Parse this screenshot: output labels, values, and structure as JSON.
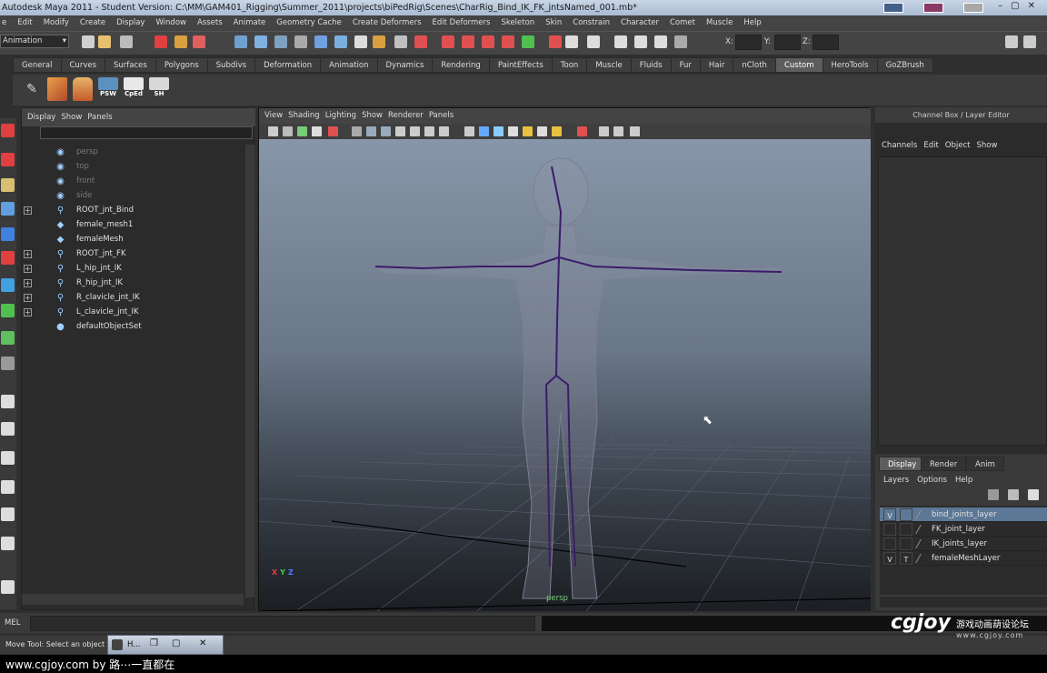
{
  "window": {
    "title": "Autodesk Maya 2011 - Student Version: C:\\MM\\GAM401_Rigging\\Summer_2011\\projects\\biPedRig\\Scenes\\CharRig_Bind_IK_FK_jntsNamed_001.mb*"
  },
  "menubar": [
    "e",
    "Edit",
    "Modify",
    "Create",
    "Display",
    "Window",
    "Assets",
    "Animate",
    "Geometry Cache",
    "Create Deformers",
    "Edit Deformers",
    "Skeleton",
    "Skin",
    "Constrain",
    "Character",
    "Comet",
    "Muscle",
    "Help"
  ],
  "statusline": {
    "mode": "Animation",
    "x_label": "X:",
    "y_label": "Y:",
    "z_label": "Z:"
  },
  "shelf": {
    "tabs": [
      "General",
      "Curves",
      "Surfaces",
      "Polygons",
      "Subdivs",
      "Deformation",
      "Animation",
      "Dynamics",
      "Rendering",
      "PaintEffects",
      "Toon",
      "Muscle",
      "Fluids",
      "Fur",
      "Hair",
      "nCloth",
      "Custom",
      "HeroTools",
      "GoZBrush"
    ],
    "active_tab": "Custom",
    "buttons": [
      "PSW",
      "CpEd",
      "SH"
    ]
  },
  "outliner": {
    "menu": [
      "Display",
      "Show",
      "Panels"
    ],
    "items": [
      {
        "label": "persp",
        "expandable": false,
        "dim": true,
        "icon": "camera-icon"
      },
      {
        "label": "top",
        "expandable": false,
        "dim": true,
        "icon": "camera-icon"
      },
      {
        "label": "front",
        "expandable": false,
        "dim": true,
        "icon": "camera-icon"
      },
      {
        "label": "side",
        "expandable": false,
        "dim": true,
        "icon": "camera-icon"
      },
      {
        "label": "ROOT_jnt_Bind",
        "expandable": true,
        "dim": false,
        "icon": "joint-icon"
      },
      {
        "label": "female_mesh1",
        "expandable": false,
        "dim": false,
        "icon": "mesh-icon"
      },
      {
        "label": "femaleMesh",
        "expandable": false,
        "dim": false,
        "icon": "mesh-icon"
      },
      {
        "label": "ROOT_jnt_FK",
        "expandable": true,
        "dim": false,
        "icon": "joint-icon"
      },
      {
        "label": "L_hip_jnt_IK",
        "expandable": true,
        "dim": false,
        "icon": "joint-icon"
      },
      {
        "label": "R_hip_jnt_IK",
        "expandable": true,
        "dim": false,
        "icon": "joint-icon"
      },
      {
        "label": "R_clavicle_jnt_IK",
        "expandable": true,
        "dim": false,
        "icon": "joint-icon"
      },
      {
        "label": "L_clavicle_jnt_IK",
        "expandable": true,
        "dim": false,
        "icon": "joint-icon"
      },
      {
        "label": "defaultObjectSet",
        "expandable": false,
        "dim": false,
        "icon": "set-icon"
      }
    ]
  },
  "viewport": {
    "menu": [
      "View",
      "Shading",
      "Lighting",
      "Show",
      "Renderer",
      "Panels"
    ],
    "camera": "persp",
    "axes": {
      "x": "X",
      "y": "Y",
      "z": "Z"
    }
  },
  "channelbox": {
    "header": "Channel Box / Layer Editor",
    "menu": [
      "Channels",
      "Edit",
      "Object",
      "Show"
    ]
  },
  "layer_editor": {
    "tabs": [
      "Display",
      "Render",
      "Anim"
    ],
    "active_tab": "Display",
    "menu": [
      "Layers",
      "Options",
      "Help"
    ],
    "layers": [
      {
        "visible": "V",
        "type": "",
        "name": "bind_joints_layer",
        "selected": true
      },
      {
        "visible": "",
        "type": "",
        "name": "FK_joint_layer",
        "selected": false
      },
      {
        "visible": "",
        "type": "",
        "name": "IK_joints_layer",
        "selected": false
      },
      {
        "visible": "V",
        "type": "T",
        "name": "femaleMeshLayer",
        "selected": false
      }
    ]
  },
  "commandline": {
    "label": "MEL"
  },
  "helpline": {
    "text": "Move Tool: Select an object to"
  },
  "taskbar": {
    "label": "H..."
  },
  "watermark": {
    "text": "www.cgjoy.com by 路⋯一直都在",
    "logo": "cgjoy",
    "logo_sub": "游戏动画葫设论坛",
    "logo_url": "www.cgjoy.com"
  },
  "colors": {
    "accent": "#5c7896",
    "viewport_top": "#8796a8",
    "viewport_bottom": "#1b1e22",
    "wire": "#5a3a8a"
  }
}
